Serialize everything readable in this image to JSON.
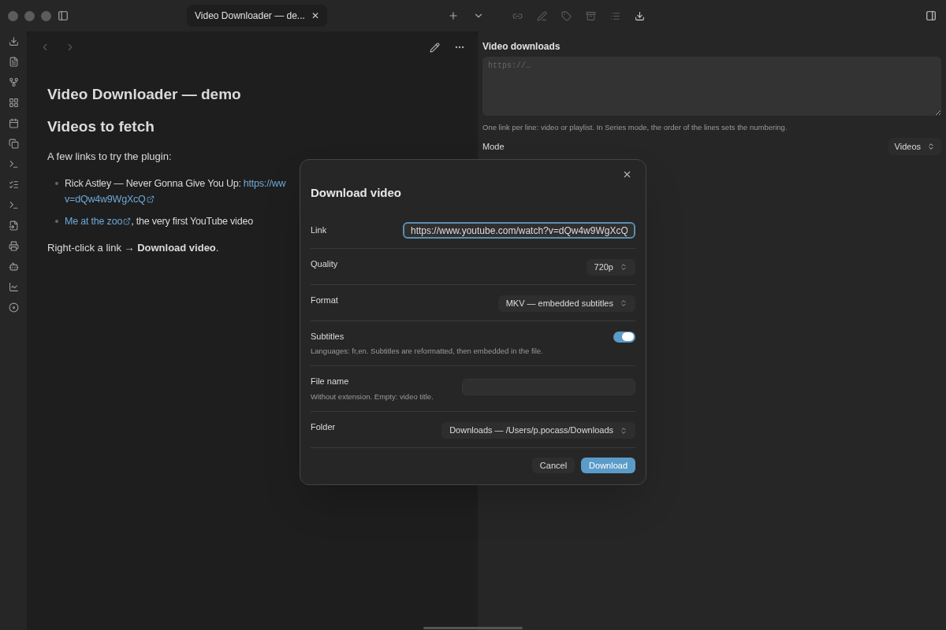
{
  "tab": {
    "title": "Video Downloader — de...",
    "close": "✕"
  },
  "note": {
    "title": "Video Downloader — demo",
    "heading": "Videos to fetch",
    "intro": "A few links to try the plugin:",
    "bullets": [
      {
        "text": "Rick Astley — Never Gonna Give You Up: ",
        "link": "https://ww",
        "link_cont": "v=dQw4w9WgXcQ"
      },
      {
        "link": "Me at the zoo",
        "tail": ", the very first YouTube video"
      }
    ],
    "footer": "Right-click a link → **Download video**."
  },
  "panel": {
    "title": "Video downloads",
    "placeholder": "https://…",
    "hint": "One link per line: video or playlist. In Series mode, the order of the lines sets the numbering.",
    "mode_label": "Mode",
    "mode_value": "Videos"
  },
  "dialog": {
    "title": "Download video",
    "rows": [
      {
        "kind": "text",
        "label": "Link",
        "value": "https://www.youtube.com/watch?v=dQw4w9WgXcQ",
        "focused": true
      },
      {
        "kind": "select",
        "label": "Quality",
        "value": "720p"
      },
      {
        "kind": "select",
        "label": "Format",
        "value": "MKV — embedded subtitles"
      },
      {
        "kind": "toggle",
        "label": "Subtitles",
        "description": "Languages: fr,en. Subtitles are reformatted, then embedded in the file.",
        "on": true
      },
      {
        "kind": "text",
        "label": "File name",
        "description": "Without extension. Empty: video title.",
        "value": "",
        "focused": false
      },
      {
        "kind": "select",
        "label": "Folder",
        "value": "Downloads — /Users/p.pocass/Downloads"
      }
    ],
    "buttons": [
      {
        "label": "Cancel",
        "primary": false
      },
      {
        "label": "Download",
        "primary": true
      }
    ]
  }
}
